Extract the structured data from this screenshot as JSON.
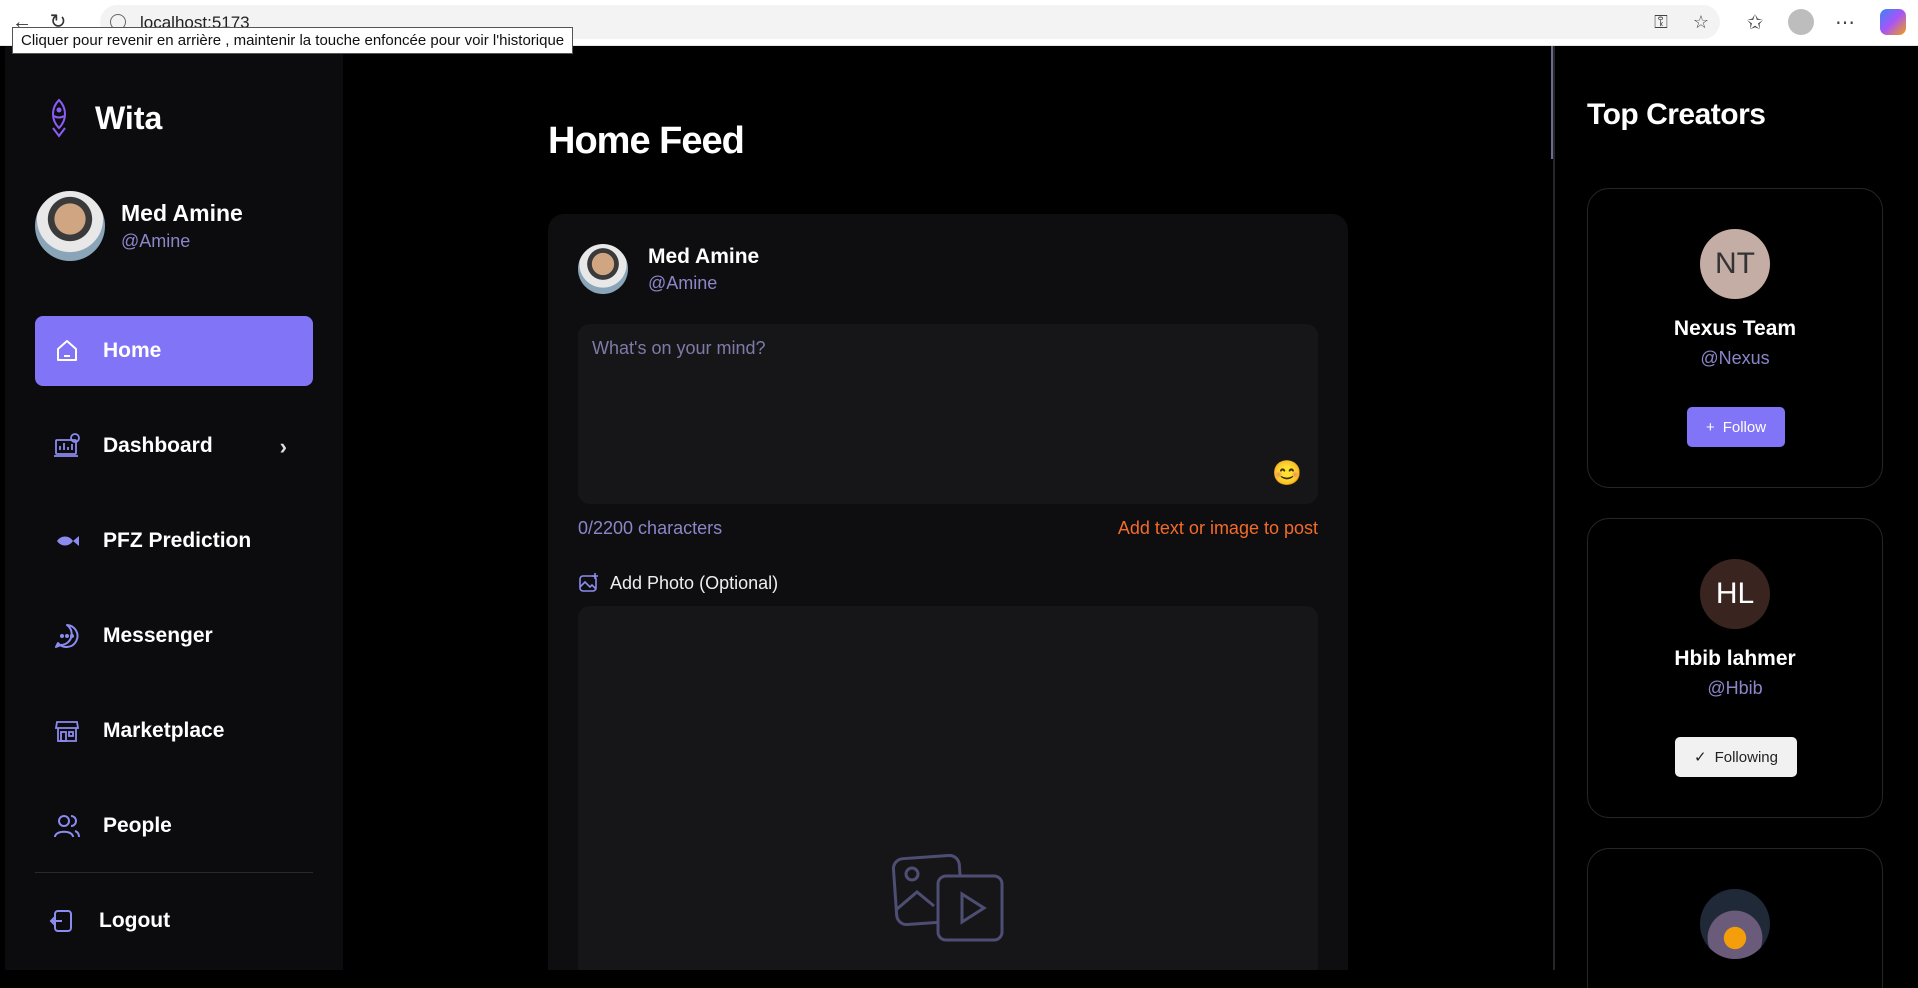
{
  "browser": {
    "url": "localhost:5173",
    "back_tooltip": "Cliquer pour revenir en arrière , maintenir la touche enfoncée pour voir l'historique",
    "icons": [
      "back-icon",
      "reload-icon",
      "info-icon",
      "key-icon",
      "star-icon",
      "favorites-icon",
      "profile-icon",
      "more-icon",
      "copilot-icon"
    ]
  },
  "brand": {
    "name": "Wita",
    "icon": "fish-logo-icon"
  },
  "user": {
    "name": "Med Amine",
    "handle": "@Amine"
  },
  "nav": {
    "items": [
      {
        "label": "Home",
        "icon": "home-icon",
        "active": true
      },
      {
        "label": "Dashboard",
        "icon": "dashboard-icon",
        "has_submenu": true
      },
      {
        "label": "PFZ Prediction",
        "icon": "fish-icon"
      },
      {
        "label": "Messenger",
        "icon": "chat-icon"
      },
      {
        "label": "Marketplace",
        "icon": "store-icon"
      },
      {
        "label": "People",
        "icon": "people-icon"
      }
    ],
    "logout": {
      "label": "Logout",
      "icon": "logout-icon"
    }
  },
  "feed": {
    "title": "Home Feed",
    "composer": {
      "author_name": "Med Amine",
      "author_handle": "@Amine",
      "placeholder": "What's on your mind?",
      "emoji": "😊",
      "counter": "0/2200 characters",
      "hint": "Add text or image to post",
      "photo_label": "Add Photo (Optional)"
    }
  },
  "top_creators": {
    "title": "Top Creators",
    "creators": [
      {
        "initials": "NT",
        "name": "Nexus Team",
        "handle": "@Nexus",
        "button": "Follow",
        "button_icon": "+",
        "avatar_color": "#c4ada4",
        "initials_color": "#333333"
      },
      {
        "initials": "HL",
        "name": "Hbib lahmer",
        "handle": "@Hbib",
        "button": "Following",
        "button_icon": "✓",
        "avatar_color": "#3a241f",
        "initials_color": "#ffffff"
      }
    ]
  },
  "colors": {
    "accent": "#8174f6",
    "muted_text": "#8a86c8",
    "warning": "#f26b2a"
  }
}
